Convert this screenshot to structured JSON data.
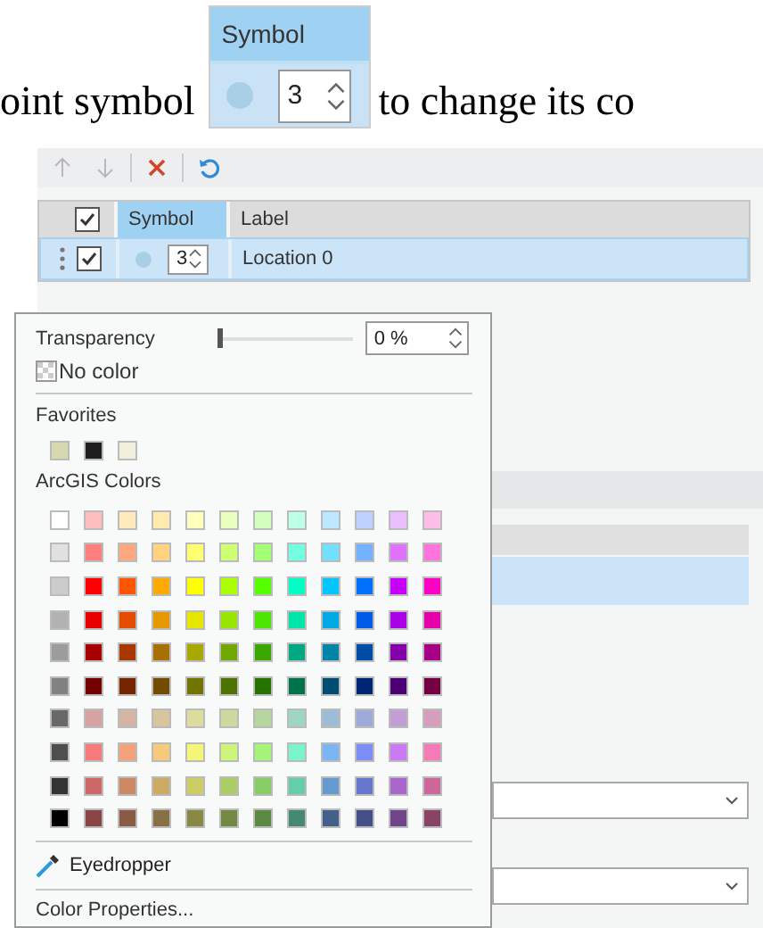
{
  "document": {
    "text_before": "oint symbol",
    "inline_symbol": {
      "header": "Symbol",
      "value": "3"
    },
    "text_after": "to change its co"
  },
  "toolbar": {
    "buttons": [
      {
        "kind": "up",
        "disabled": true
      },
      {
        "kind": "down",
        "disabled": true
      },
      {
        "kind": "delete",
        "disabled": false
      },
      {
        "kind": "reset",
        "disabled": false
      }
    ]
  },
  "table": {
    "header_checked": true,
    "columns": [
      {
        "label": "Symbol",
        "selected": true
      },
      {
        "label": "Label",
        "selected": false
      }
    ],
    "rows": [
      {
        "checked": true,
        "selected": true,
        "symbol_size": "3",
        "label": "Location 0"
      }
    ]
  },
  "background": {
    "dropdowns": [
      {
        "expanded": false
      },
      {
        "expanded": false
      }
    ]
  },
  "color_popup": {
    "transparency": {
      "label": "Transparency",
      "level": 0,
      "value": "0 %"
    },
    "no_color": "No color",
    "favorites": {
      "title": "Favorites",
      "colors": [
        {
          "color": "#d7d7b0"
        },
        {
          "color": "#1e1e1e"
        },
        {
          "color": "#f0f0dc"
        }
      ]
    },
    "palette": {
      "title": "ArcGIS Colors",
      "rows": [
        {
          "swatches": [
            {
              "color": "#ffffff"
            },
            {
              "color": "#ffbebe"
            },
            {
              "color": "#ffebbe"
            },
            {
              "color": "#ffebaf"
            },
            {
              "color": "#ffffbe"
            },
            {
              "color": "#e9ffbe"
            },
            {
              "color": "#d3ffbe"
            },
            {
              "color": "#beffe8"
            },
            {
              "color": "#bee8ff"
            },
            {
              "color": "#bed2ff"
            },
            {
              "color": "#e8beff"
            },
            {
              "color": "#ffbee8"
            }
          ]
        },
        {
          "swatches": [
            {
              "color": "#e1e1e1"
            },
            {
              "color": "#ff7f7f"
            },
            {
              "color": "#ffa77f"
            },
            {
              "color": "#ffd37f"
            },
            {
              "color": "#ffff73"
            },
            {
              "color": "#d1ff73"
            },
            {
              "color": "#a3ff73"
            },
            {
              "color": "#73ffdf"
            },
            {
              "color": "#73dfff"
            },
            {
              "color": "#73b2ff"
            },
            {
              "color": "#df73ff"
            },
            {
              "color": "#ff73df"
            }
          ]
        },
        {
          "swatches": [
            {
              "color": "#cccccc"
            },
            {
              "color": "#ff0000"
            },
            {
              "color": "#ff5500"
            },
            {
              "color": "#ffaa00"
            },
            {
              "color": "#ffff00"
            },
            {
              "color": "#aaff00"
            },
            {
              "color": "#55ff00"
            },
            {
              "color": "#00ffc5"
            },
            {
              "color": "#00c5ff"
            },
            {
              "color": "#0070ff"
            },
            {
              "color": "#c500ff"
            },
            {
              "color": "#ff00c5"
            }
          ]
        },
        {
          "swatches": [
            {
              "color": "#b2b2b2"
            },
            {
              "color": "#e60000"
            },
            {
              "color": "#e64c00"
            },
            {
              "color": "#e69800"
            },
            {
              "color": "#e6e600"
            },
            {
              "color": "#98e600"
            },
            {
              "color": "#4ce600"
            },
            {
              "color": "#00e6a9"
            },
            {
              "color": "#00a9e6"
            },
            {
              "color": "#005ce6"
            },
            {
              "color": "#a900e6"
            },
            {
              "color": "#e600a9"
            }
          ]
        },
        {
          "swatches": [
            {
              "color": "#9c9c9c"
            },
            {
              "color": "#a80000"
            },
            {
              "color": "#a83800"
            },
            {
              "color": "#a87000"
            },
            {
              "color": "#a8a800"
            },
            {
              "color": "#70a800"
            },
            {
              "color": "#38a800"
            },
            {
              "color": "#00a884"
            },
            {
              "color": "#0084a8"
            },
            {
              "color": "#004da8"
            },
            {
              "color": "#8400a8"
            },
            {
              "color": "#a80084"
            }
          ]
        },
        {
          "swatches": [
            {
              "color": "#828282"
            },
            {
              "color": "#730000"
            },
            {
              "color": "#732600"
            },
            {
              "color": "#734c00"
            },
            {
              "color": "#737300"
            },
            {
              "color": "#4c7300"
            },
            {
              "color": "#267300"
            },
            {
              "color": "#00734c"
            },
            {
              "color": "#004c73"
            },
            {
              "color": "#002673"
            },
            {
              "color": "#4c0073"
            },
            {
              "color": "#730040"
            }
          ]
        },
        {
          "swatches": [
            {
              "color": "#686868"
            },
            {
              "color": "#d6a3a3"
            },
            {
              "color": "#d6b4a3"
            },
            {
              "color": "#d8c59e"
            },
            {
              "color": "#dcdc9e"
            },
            {
              "color": "#cdda9e"
            },
            {
              "color": "#b5d69e"
            },
            {
              "color": "#9ed6c2"
            },
            {
              "color": "#9ebbd7"
            },
            {
              "color": "#9eaad7"
            },
            {
              "color": "#c29ed7"
            },
            {
              "color": "#d69dbc"
            }
          ]
        },
        {
          "swatches": [
            {
              "color": "#4e4e4e"
            },
            {
              "color": "#f57a7a"
            },
            {
              "color": "#f5a27a"
            },
            {
              "color": "#f5ca7a"
            },
            {
              "color": "#f5f57a"
            },
            {
              "color": "#cdf57a"
            },
            {
              "color": "#a5f57a"
            },
            {
              "color": "#7af5ca"
            },
            {
              "color": "#7ab6f5"
            },
            {
              "color": "#7a8ef5"
            },
            {
              "color": "#ca7af5"
            },
            {
              "color": "#f57ab6"
            }
          ]
        },
        {
          "swatches": [
            {
              "color": "#343434"
            },
            {
              "color": "#cd6666"
            },
            {
              "color": "#cd8966"
            },
            {
              "color": "#cdaa66"
            },
            {
              "color": "#cdcd66"
            },
            {
              "color": "#abcd66"
            },
            {
              "color": "#89cd66"
            },
            {
              "color": "#66cdab"
            },
            {
              "color": "#6699cd"
            },
            {
              "color": "#6677cd"
            },
            {
              "color": "#a866cd"
            },
            {
              "color": "#cd6699"
            }
          ]
        },
        {
          "swatches": [
            {
              "color": "#000000"
            },
            {
              "color": "#894444"
            },
            {
              "color": "#895a44"
            },
            {
              "color": "#897044"
            },
            {
              "color": "#898944"
            },
            {
              "color": "#728944"
            },
            {
              "color": "#5c8944"
            },
            {
              "color": "#448970"
            },
            {
              "color": "#445f89"
            },
            {
              "color": "#444f89"
            },
            {
              "color": "#704489"
            },
            {
              "color": "#894465"
            }
          ]
        }
      ]
    },
    "eyedropper": "Eyedropper",
    "properties": "Color Properties..."
  }
}
